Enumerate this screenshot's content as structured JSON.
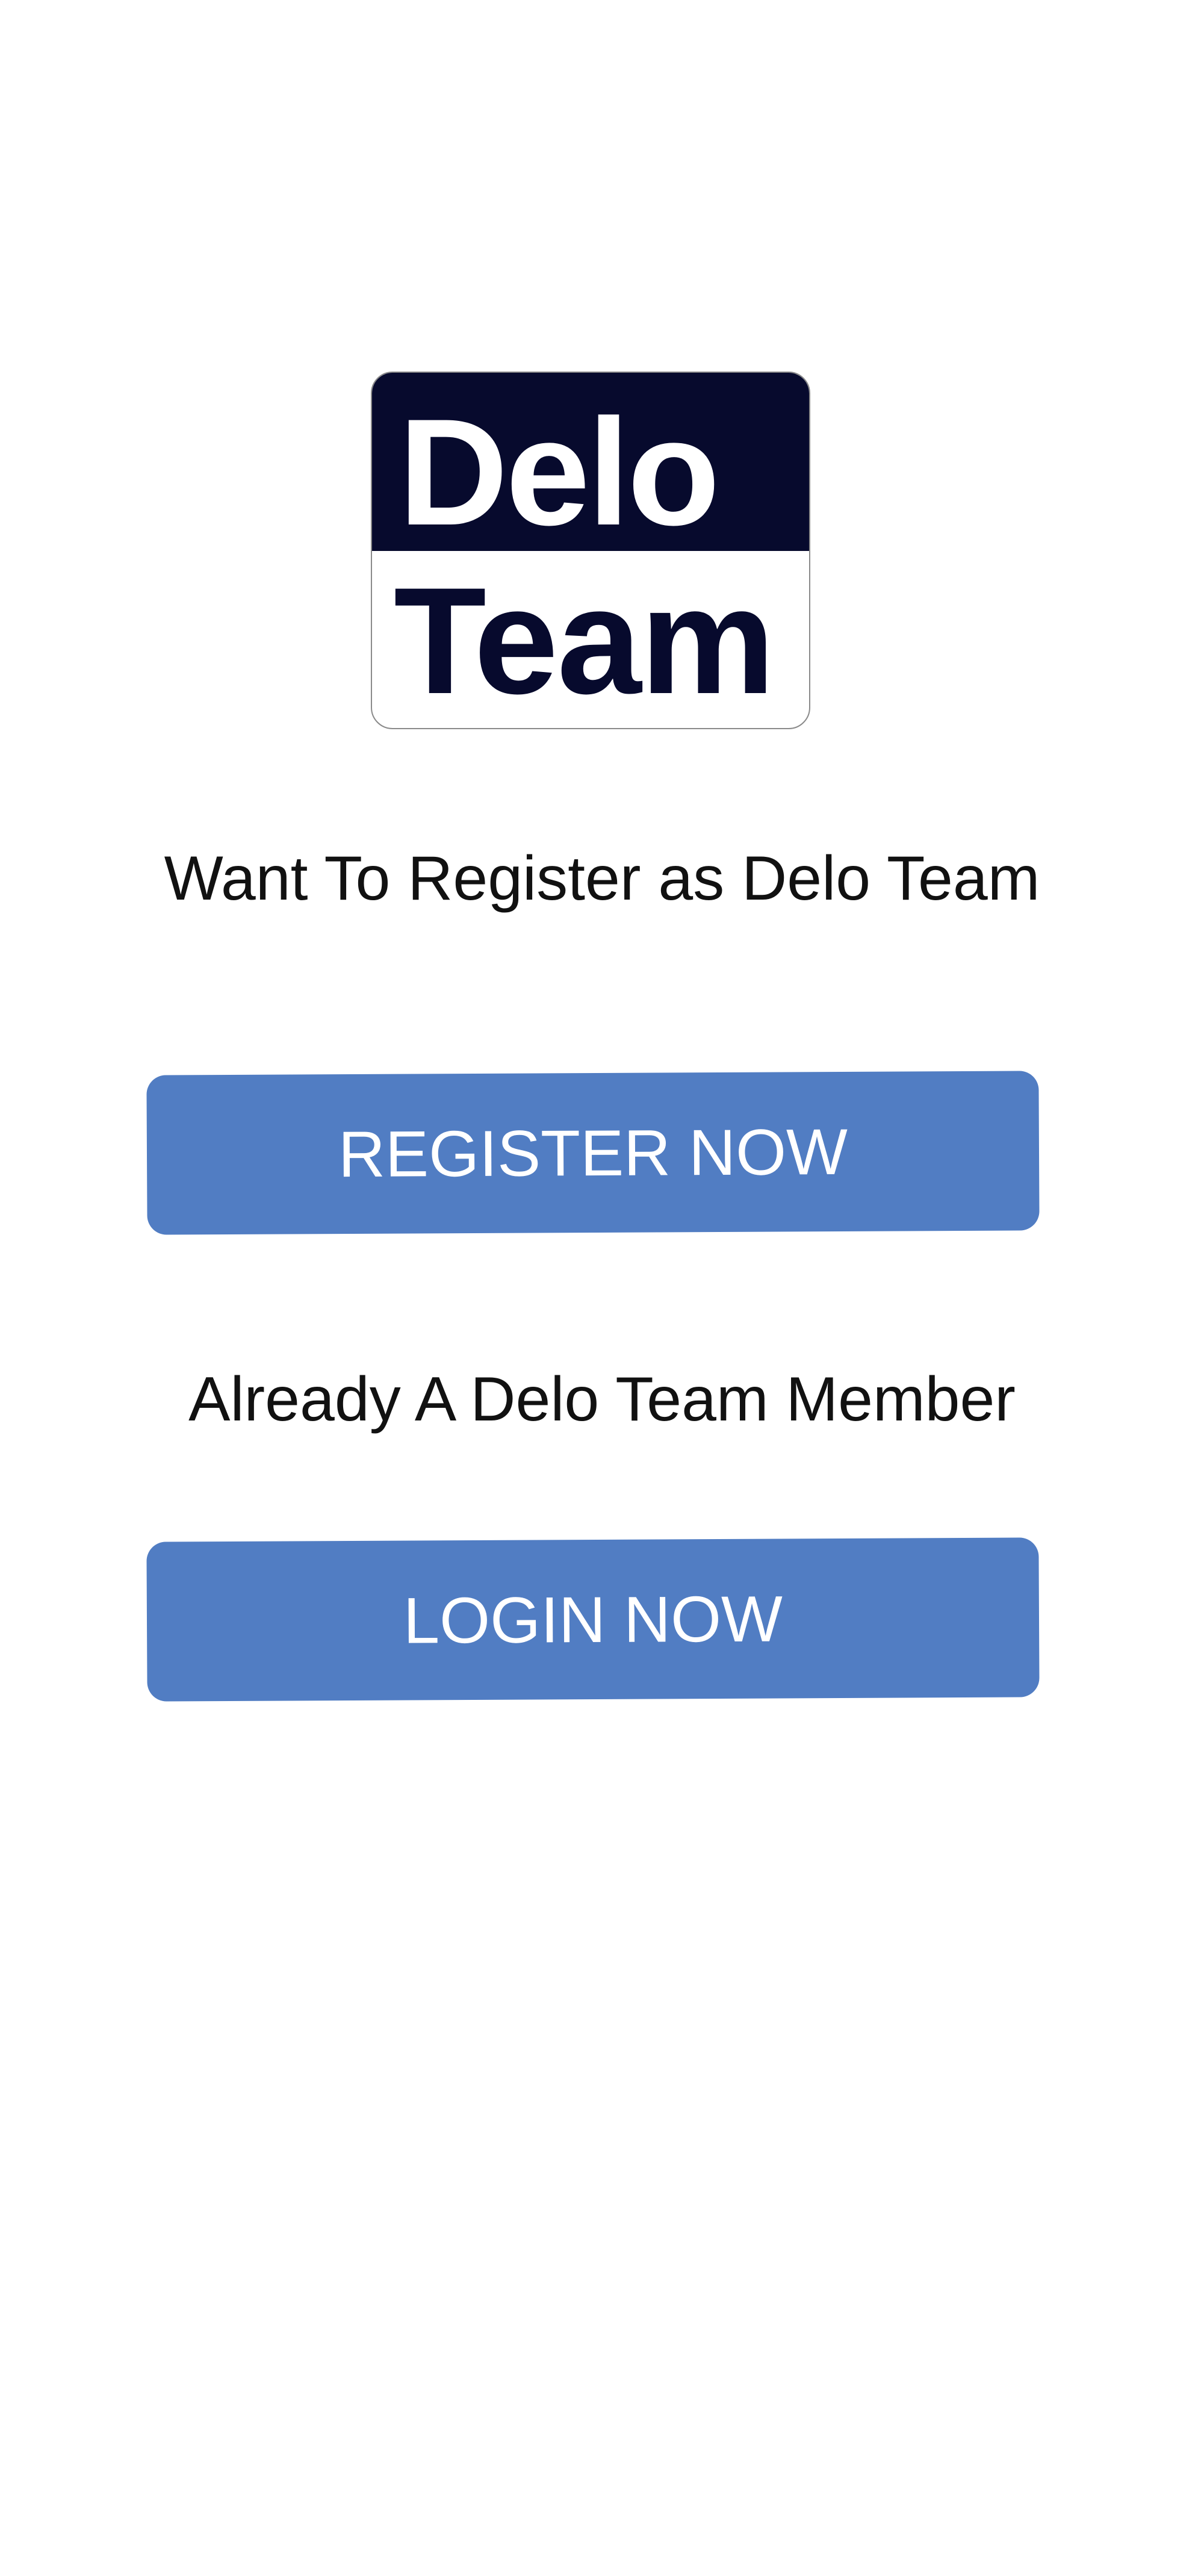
{
  "logo": {
    "word_top": "Delo",
    "word_bottom": "Team",
    "colors": {
      "navy": "#070a2d",
      "white": "#ffffff"
    }
  },
  "register": {
    "prompt": "Want To Register as Delo Team",
    "button_label": "REGISTER NOW"
  },
  "login": {
    "prompt": "Already A Delo Team Member",
    "button_label": "LOGIN NOW"
  },
  "colors": {
    "button_bg": "#517dc3",
    "button_text": "#ffffff",
    "text": "#111111",
    "background": "#ffffff"
  }
}
